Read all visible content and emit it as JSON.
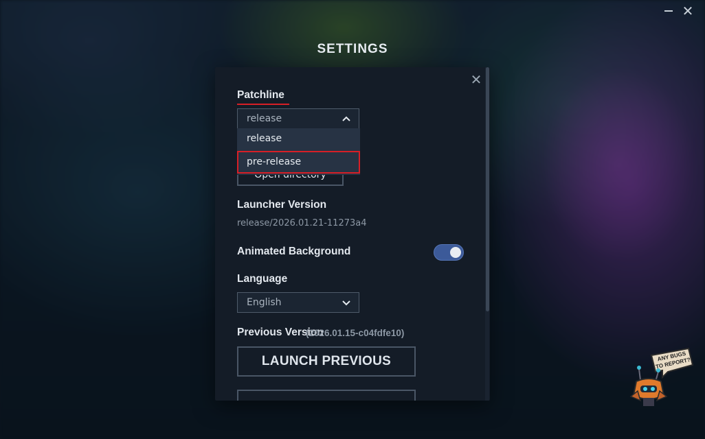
{
  "window": {
    "title": "SETTINGS",
    "minimize_icon": "minimize-icon",
    "close_glyph": "✕"
  },
  "panel": {
    "close_glyph": "✕",
    "patchline": {
      "label": "Patchline",
      "selected": "release",
      "options": [
        "release",
        "pre-release"
      ]
    },
    "open_directory_label": "Open directory",
    "launcher_version": {
      "label": "Launcher Version",
      "value": "release/2026.01.21-11273a4"
    },
    "animated_background": {
      "label": "Animated Background",
      "enabled": true
    },
    "language": {
      "label": "Language",
      "selected": "English"
    },
    "previous_version": {
      "label": "Previous Version",
      "value": "(2026.01.15-c04fdfe10)",
      "button_label": "LAUNCH PREVIOUS"
    }
  },
  "bug_report": {
    "text": "ANY BUGS TO REPORT?",
    "icon": "bug-mascot-icon"
  },
  "colors": {
    "accent_red": "#d81f26",
    "toggle_on": "#3c5a99",
    "panel_bg": "#141c27"
  }
}
